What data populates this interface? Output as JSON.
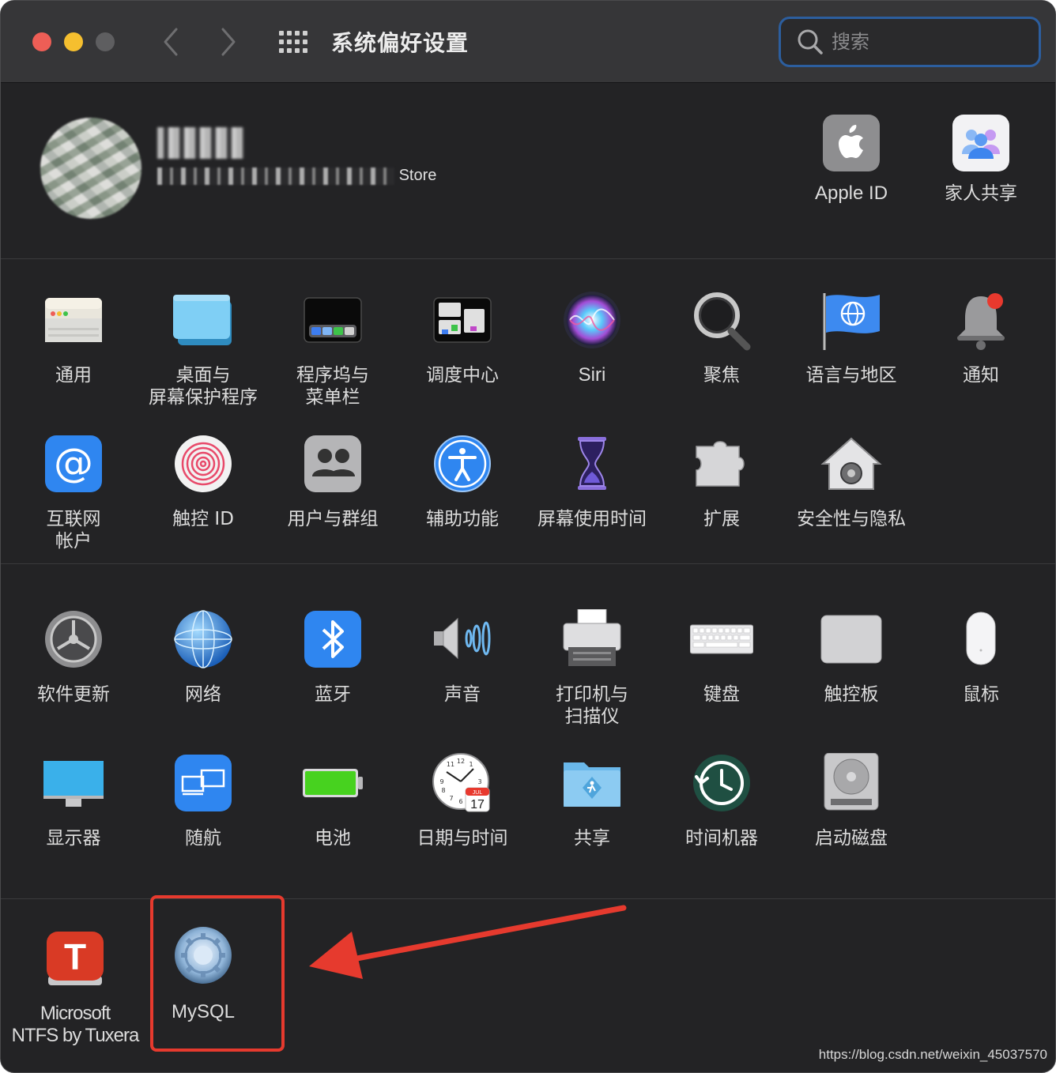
{
  "window": {
    "title": "系统偏好设置",
    "search_placeholder": "搜索"
  },
  "account": {
    "subtitle_tail": "Store"
  },
  "top_right": [
    {
      "label": "Apple ID",
      "icon": "apple-icon"
    },
    {
      "label": "家人共享",
      "icon": "family-sharing-icon"
    }
  ],
  "section1": [
    {
      "label": "通用",
      "icon": "general-icon"
    },
    {
      "label": "桌面与\n屏幕保护程序",
      "icon": "desktop-screensaver-icon"
    },
    {
      "label": "程序坞与\n菜单栏",
      "icon": "dock-menubar-icon"
    },
    {
      "label": "调度中心",
      "icon": "mission-control-icon"
    },
    {
      "label": "Siri",
      "icon": "siri-icon"
    },
    {
      "label": "聚焦",
      "icon": "spotlight-icon"
    },
    {
      "label": "语言与地区",
      "icon": "language-region-icon"
    },
    {
      "label": "通知",
      "icon": "notifications-icon"
    },
    {
      "label": "互联网\n帐户",
      "icon": "internet-accounts-icon"
    },
    {
      "label": "触控 ID",
      "icon": "touch-id-icon"
    },
    {
      "label": "用户与群组",
      "icon": "users-groups-icon"
    },
    {
      "label": "辅助功能",
      "icon": "accessibility-icon"
    },
    {
      "label": "屏幕使用时间",
      "icon": "screen-time-icon"
    },
    {
      "label": "扩展",
      "icon": "extensions-icon"
    },
    {
      "label": "安全性与隐私",
      "icon": "security-privacy-icon"
    }
  ],
  "section2": [
    {
      "label": "软件更新",
      "icon": "software-update-icon"
    },
    {
      "label": "网络",
      "icon": "network-icon"
    },
    {
      "label": "蓝牙",
      "icon": "bluetooth-icon"
    },
    {
      "label": "声音",
      "icon": "sound-icon"
    },
    {
      "label": "打印机与\n扫描仪",
      "icon": "printers-scanners-icon"
    },
    {
      "label": "键盘",
      "icon": "keyboard-icon"
    },
    {
      "label": "触控板",
      "icon": "trackpad-icon"
    },
    {
      "label": "鼠标",
      "icon": "mouse-icon"
    },
    {
      "label": "显示器",
      "icon": "displays-icon"
    },
    {
      "label": "随航",
      "icon": "sidecar-icon"
    },
    {
      "label": "电池",
      "icon": "battery-icon"
    },
    {
      "label": "日期与时间",
      "icon": "date-time-icon"
    },
    {
      "label": "共享",
      "icon": "sharing-icon"
    },
    {
      "label": "时间机器",
      "icon": "time-machine-icon"
    },
    {
      "label": "启动磁盘",
      "icon": "startup-disk-icon"
    }
  ],
  "section3": [
    {
      "label": "Microsoft\nNTFS by Tuxera",
      "icon": "tuxera-ntfs-icon"
    },
    {
      "label": "MySQL",
      "icon": "mysql-icon"
    }
  ],
  "calendar_icon": {
    "month": "JUL",
    "day": "17"
  },
  "watermark": "https://blog.csdn.net/weixin_45037570",
  "colors": {
    "window_bg": "#232325",
    "titlebar_bg": "#363638",
    "highlight": "#e63a2e",
    "search_border": "#2c5e9e"
  }
}
